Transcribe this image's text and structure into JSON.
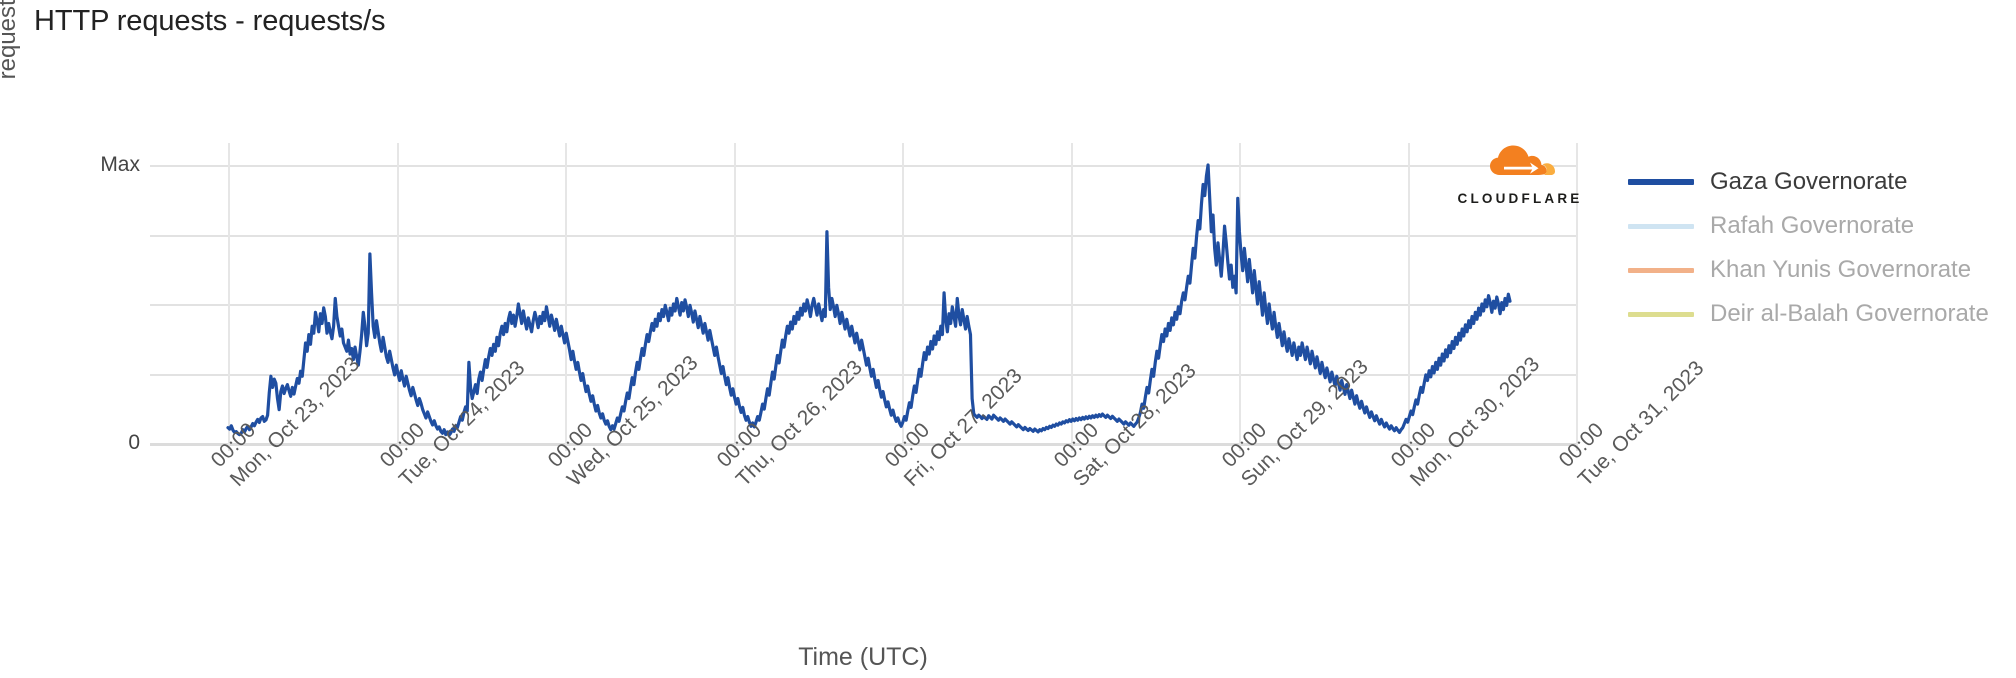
{
  "chart_data": {
    "type": "line",
    "title": "HTTP requests - requests/s",
    "xlabel": "Time (UTC)",
    "ylabel": "requests/s",
    "ytick_labels": [
      "Max",
      "0"
    ],
    "ylim": [
      0,
      1
    ],
    "grid": true,
    "legend_position": "right",
    "x_tick_labels": [
      {
        "time": "00:00",
        "date": "Mon, Oct 23, 2023"
      },
      {
        "time": "00:00",
        "date": "Tue, Oct 24, 2023"
      },
      {
        "time": "00:00",
        "date": "Wed, Oct 25, 2023"
      },
      {
        "time": "00:00",
        "date": "Thu, Oct 26, 2023"
      },
      {
        "time": "00:00",
        "date": "Fri, Oct 27, 2023"
      },
      {
        "time": "00:00",
        "date": "Sat, Oct 28, 2023"
      },
      {
        "time": "00:00",
        "date": "Sun, Oct 29, 2023"
      },
      {
        "time": "00:00",
        "date": "Mon, Oct 30, 2023"
      },
      {
        "time": "00:00",
        "date": "Tue, Oct 31, 2023"
      }
    ],
    "series": [
      {
        "name": "Gaza Governorate",
        "color": "#1f4ea1",
        "visible": true,
        "values": [
          0.055,
          0.05,
          0.062,
          0.046,
          0.038,
          0.041,
          0.034,
          0.03,
          0.035,
          0.048,
          0.04,
          0.052,
          0.06,
          0.048,
          0.058,
          0.07,
          0.062,
          0.075,
          0.085,
          0.074,
          0.09,
          0.095,
          0.078,
          0.083,
          0.1,
          0.18,
          0.24,
          0.2,
          0.23,
          0.215,
          0.16,
          0.12,
          0.185,
          0.205,
          0.178,
          0.196,
          0.21,
          0.188,
          0.168,
          0.2,
          0.176,
          0.205,
          0.232,
          0.215,
          0.258,
          0.24,
          0.3,
          0.36,
          0.33,
          0.39,
          0.355,
          0.42,
          0.395,
          0.47,
          0.44,
          0.4,
          0.465,
          0.43,
          0.486,
          0.455,
          0.395,
          0.43,
          0.4,
          0.375,
          0.42,
          0.52,
          0.455,
          0.42,
          0.385,
          0.41,
          0.36,
          0.345,
          0.33,
          0.37,
          0.32,
          0.34,
          0.3,
          0.345,
          0.31,
          0.28,
          0.33,
          0.39,
          0.47,
          0.42,
          0.35,
          0.395,
          0.68,
          0.54,
          0.42,
          0.38,
          0.44,
          0.4,
          0.36,
          0.33,
          0.38,
          0.345,
          0.31,
          0.29,
          0.33,
          0.3,
          0.27,
          0.245,
          0.28,
          0.25,
          0.225,
          0.26,
          0.23,
          0.205,
          0.24,
          0.215,
          0.19,
          0.17,
          0.2,
          0.178,
          0.155,
          0.135,
          0.16,
          0.142,
          0.12,
          0.105,
          0.09,
          0.112,
          0.095,
          0.078,
          0.065,
          0.08,
          0.062,
          0.05,
          0.058,
          0.042,
          0.035,
          0.048,
          0.03,
          0.04,
          0.028,
          0.036,
          0.05,
          0.042,
          0.062,
          0.055,
          0.075,
          0.095,
          0.082,
          0.11,
          0.13,
          0.115,
          0.29,
          0.2,
          0.16,
          0.185,
          0.21,
          0.178,
          0.23,
          0.255,
          0.225,
          0.265,
          0.3,
          0.272,
          0.31,
          0.34,
          0.315,
          0.355,
          0.33,
          0.38,
          0.35,
          0.395,
          0.42,
          0.39,
          0.43,
          0.4,
          0.445,
          0.47,
          0.43,
          0.46,
          0.42,
          0.455,
          0.5,
          0.465,
          0.43,
          0.475,
          0.44,
          0.41,
          0.45,
          0.425,
          0.4,
          0.44,
          0.47,
          0.445,
          0.415,
          0.455,
          0.43,
          0.47,
          0.44,
          0.49,
          0.455,
          0.42,
          0.46,
          0.435,
          0.405,
          0.445,
          0.415,
          0.385,
          0.42,
          0.39,
          0.36,
          0.395,
          0.365,
          0.335,
          0.3,
          0.33,
          0.295,
          0.265,
          0.29,
          0.255,
          0.225,
          0.25,
          0.215,
          0.185,
          0.205,
          0.175,
          0.15,
          0.17,
          0.14,
          0.115,
          0.135,
          0.108,
          0.09,
          0.105,
          0.082,
          0.068,
          0.08,
          0.06,
          0.048,
          0.062,
          0.05,
          0.07,
          0.09,
          0.078,
          0.105,
          0.13,
          0.115,
          0.15,
          0.18,
          0.16,
          0.2,
          0.235,
          0.21,
          0.255,
          0.29,
          0.265,
          0.305,
          0.34,
          0.315,
          0.355,
          0.39,
          0.365,
          0.4,
          0.43,
          0.405,
          0.445,
          0.42,
          0.465,
          0.44,
          0.48,
          0.455,
          0.495,
          0.47,
          0.44,
          0.485,
          0.46,
          0.5,
          0.475,
          0.52,
          0.49,
          0.46,
          0.505,
          0.475,
          0.515,
          0.488,
          0.455,
          0.495,
          0.468,
          0.435,
          0.475,
          0.445,
          0.415,
          0.455,
          0.425,
          0.395,
          0.43,
          0.4,
          0.37,
          0.405,
          0.375,
          0.345,
          0.315,
          0.345,
          0.31,
          0.28,
          0.25,
          0.275,
          0.24,
          0.21,
          0.235,
          0.2,
          0.172,
          0.195,
          0.165,
          0.14,
          0.16,
          0.132,
          0.11,
          0.128,
          0.1,
          0.082,
          0.095,
          0.075,
          0.06,
          0.072,
          0.058,
          0.075,
          0.095,
          0.082,
          0.11,
          0.14,
          0.122,
          0.16,
          0.195,
          0.172,
          0.215,
          0.255,
          0.23,
          0.275,
          0.315,
          0.288,
          0.33,
          0.37,
          0.345,
          0.385,
          0.42,
          0.395,
          0.435,
          0.41,
          0.455,
          0.43,
          0.47,
          0.445,
          0.485,
          0.46,
          0.5,
          0.475,
          0.515,
          0.488,
          0.455,
          0.495,
          0.52,
          0.49,
          0.46,
          0.5,
          0.47,
          0.44,
          0.48,
          0.455,
          0.76,
          0.56,
          0.48,
          0.52,
          0.49,
          0.455,
          0.495,
          0.465,
          0.43,
          0.47,
          0.44,
          0.41,
          0.445,
          0.415,
          0.385,
          0.42,
          0.39,
          0.36,
          0.395,
          0.365,
          0.335,
          0.37,
          0.34,
          0.31,
          0.28,
          0.305,
          0.27,
          0.24,
          0.265,
          0.23,
          0.2,
          0.225,
          0.192,
          0.165,
          0.185,
          0.155,
          0.13,
          0.148,
          0.122,
          0.1,
          0.118,
          0.095,
          0.078,
          0.09,
          0.072,
          0.06,
          0.075,
          0.095,
          0.082,
          0.115,
          0.145,
          0.128,
          0.17,
          0.205,
          0.182,
          0.225,
          0.265,
          0.24,
          0.285,
          0.325,
          0.3,
          0.345,
          0.32,
          0.365,
          0.338,
          0.385,
          0.355,
          0.4,
          0.372,
          0.42,
          0.39,
          0.54,
          0.445,
          0.4,
          0.465,
          0.43,
          0.49,
          0.455,
          0.42,
          0.52,
          0.46,
          0.425,
          0.48,
          0.445,
          0.41,
          0.455,
          0.42,
          0.39,
          0.16,
          0.105,
          0.098,
          0.092,
          0.1,
          0.095,
          0.088,
          0.096,
          0.09,
          0.085,
          0.098,
          0.092,
          0.086,
          0.1,
          0.094,
          0.088,
          0.082,
          0.09,
          0.084,
          0.078,
          0.086,
          0.08,
          0.074,
          0.068,
          0.076,
          0.07,
          0.064,
          0.058,
          0.066,
          0.06,
          0.054,
          0.048,
          0.056,
          0.05,
          0.045,
          0.052,
          0.047,
          0.042,
          0.05,
          0.045,
          0.04,
          0.048,
          0.044,
          0.052,
          0.048,
          0.056,
          0.052,
          0.06,
          0.056,
          0.064,
          0.06,
          0.068,
          0.064,
          0.072,
          0.068,
          0.076,
          0.072,
          0.08,
          0.076,
          0.084,
          0.078,
          0.086,
          0.08,
          0.088,
          0.082,
          0.09,
          0.084,
          0.092,
          0.086,
          0.094,
          0.088,
          0.096,
          0.09,
          0.098,
          0.092,
          0.1,
          0.094,
          0.102,
          0.096,
          0.104,
          0.098,
          0.092,
          0.1,
          0.094,
          0.088,
          0.096,
          0.09,
          0.084,
          0.078,
          0.086,
          0.08,
          0.074,
          0.068,
          0.076,
          0.07,
          0.064,
          0.072,
          0.066,
          0.06,
          0.068,
          0.075,
          0.09,
          0.11,
          0.14,
          0.125,
          0.165,
          0.2,
          0.18,
          0.225,
          0.265,
          0.24,
          0.29,
          0.33,
          0.305,
          0.35,
          0.39,
          0.365,
          0.41,
          0.385,
          0.43,
          0.405,
          0.45,
          0.425,
          0.47,
          0.445,
          0.49,
          0.465,
          0.51,
          0.54,
          0.515,
          0.56,
          0.6,
          0.575,
          0.64,
          0.7,
          0.665,
          0.74,
          0.8,
          0.77,
          0.86,
          0.93,
          0.89,
          0.96,
          1.0,
          0.88,
          0.76,
          0.82,
          0.7,
          0.64,
          0.72,
          0.66,
          0.6,
          0.68,
          0.78,
          0.72,
          0.65,
          0.59,
          0.64,
          0.56,
          0.6,
          0.54,
          0.88,
          0.76,
          0.68,
          0.62,
          0.7,
          0.64,
          0.58,
          0.66,
          0.6,
          0.54,
          0.62,
          0.56,
          0.5,
          0.58,
          0.52,
          0.46,
          0.54,
          0.48,
          0.43,
          0.5,
          0.45,
          0.41,
          0.47,
          0.42,
          0.38,
          0.43,
          0.39,
          0.35,
          0.4,
          0.36,
          0.33,
          0.375,
          0.345,
          0.315,
          0.36,
          0.33,
          0.3,
          0.345,
          0.315,
          0.36,
          0.33,
          0.3,
          0.345,
          0.315,
          0.285,
          0.33,
          0.3,
          0.27,
          0.31,
          0.28,
          0.25,
          0.29,
          0.26,
          0.235,
          0.27,
          0.245,
          0.22,
          0.255,
          0.23,
          0.205,
          0.24,
          0.215,
          0.19,
          0.225,
          0.2,
          0.175,
          0.21,
          0.185,
          0.16,
          0.19,
          0.165,
          0.14,
          0.17,
          0.145,
          0.125,
          0.15,
          0.128,
          0.108,
          0.13,
          0.11,
          0.092,
          0.112,
          0.095,
          0.08,
          0.098,
          0.082,
          0.068,
          0.085,
          0.07,
          0.058,
          0.072,
          0.06,
          0.05,
          0.062,
          0.052,
          0.044,
          0.055,
          0.046,
          0.038,
          0.048,
          0.055,
          0.07,
          0.085,
          0.075,
          0.095,
          0.115,
          0.102,
          0.13,
          0.155,
          0.14,
          0.172,
          0.2,
          0.182,
          0.215,
          0.245,
          0.225,
          0.26,
          0.238,
          0.275,
          0.252,
          0.29,
          0.265,
          0.305,
          0.28,
          0.32,
          0.295,
          0.335,
          0.31,
          0.35,
          0.325,
          0.365,
          0.34,
          0.38,
          0.355,
          0.395,
          0.37,
          0.41,
          0.385,
          0.425,
          0.4,
          0.44,
          0.415,
          0.455,
          0.43,
          0.47,
          0.445,
          0.485,
          0.46,
          0.5,
          0.475,
          0.515,
          0.49,
          0.53,
          0.505,
          0.47,
          0.51,
          0.485,
          0.525,
          0.5,
          0.465,
          0.505,
          0.48,
          0.52,
          0.495,
          0.535,
          0.51
        ]
      },
      {
        "name": "Rafah Governorate",
        "color": "#cfe4f2",
        "visible": false,
        "values": []
      },
      {
        "name": "Khan Yunis Governorate",
        "color": "#f2b189",
        "visible": false,
        "values": []
      },
      {
        "name": "Deir al-Balah Governorate",
        "color": "#dddd8f",
        "visible": false,
        "values": []
      }
    ]
  },
  "watermark": {
    "brand": "CLOUDFLARE"
  }
}
